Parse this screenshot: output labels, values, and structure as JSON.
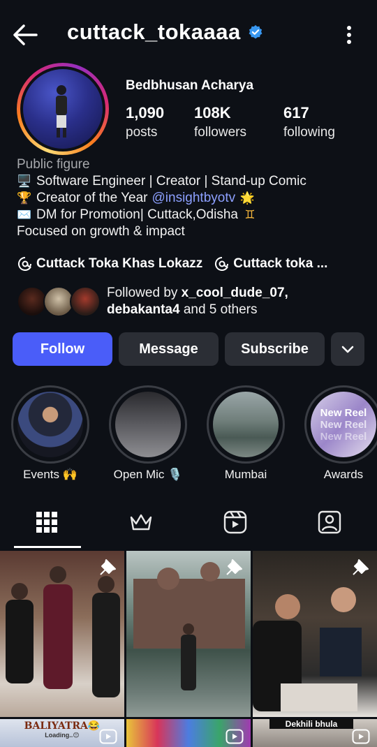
{
  "header": {
    "username": "cuttack_tokaaaa"
  },
  "profile": {
    "display_name": "Bedbhusan Acharya",
    "stats": [
      {
        "value": "1,090",
        "label": "posts"
      },
      {
        "value": "108K",
        "label": "followers"
      },
      {
        "value": "617",
        "label": "following"
      }
    ]
  },
  "bio": {
    "category": "Public figure",
    "line1": "Software Engineer | Creator | Stand-up Comic",
    "line2_pre": "Creator of the Year ",
    "line2_mention": "@insightbyotv",
    "line3": "DM for Promotion| Cuttack,Odisha",
    "line4": "Focused on growth & impact",
    "emoji": {
      "computer": "🖥️",
      "trophy": "🏆",
      "star": "🌟",
      "envelope": "✉️",
      "gemini": "♊"
    }
  },
  "links": [
    {
      "label": "Cuttack Toka Khas Lokazz"
    },
    {
      "label": "Cuttack toka ..."
    }
  ],
  "followed_by": {
    "prefix": "Followed by ",
    "user1": "x_cool_dude_07,",
    "user2": "debakanta4",
    "suffix": " and 5 others"
  },
  "actions": {
    "follow": "Follow",
    "message": "Message",
    "subscribe": "Subscribe"
  },
  "highlights": [
    {
      "label": "Events 🙌"
    },
    {
      "label": "Open Mic 🎙️"
    },
    {
      "label": "Mumbai"
    },
    {
      "label": "Awards"
    }
  ],
  "highlight_awards_text": "New Reel",
  "grid": {
    "captions": [
      "BALIYATRA😂",
      "Loading..😊",
      "Dekhili bhula"
    ]
  },
  "colors": {
    "background": "#0d1016",
    "follow_button": "#4a5df9",
    "secondary_button": "#2b2e35",
    "mention": "#8da0ff",
    "verified": "#3897f0"
  },
  "icons": [
    "back-arrow-icon",
    "verified-badge-icon",
    "more-options-icon",
    "threads-icon",
    "chevron-down-icon",
    "grid-icon",
    "crown-icon",
    "reels-icon",
    "tagged-icon",
    "pin-icon",
    "reel-play-icon"
  ]
}
